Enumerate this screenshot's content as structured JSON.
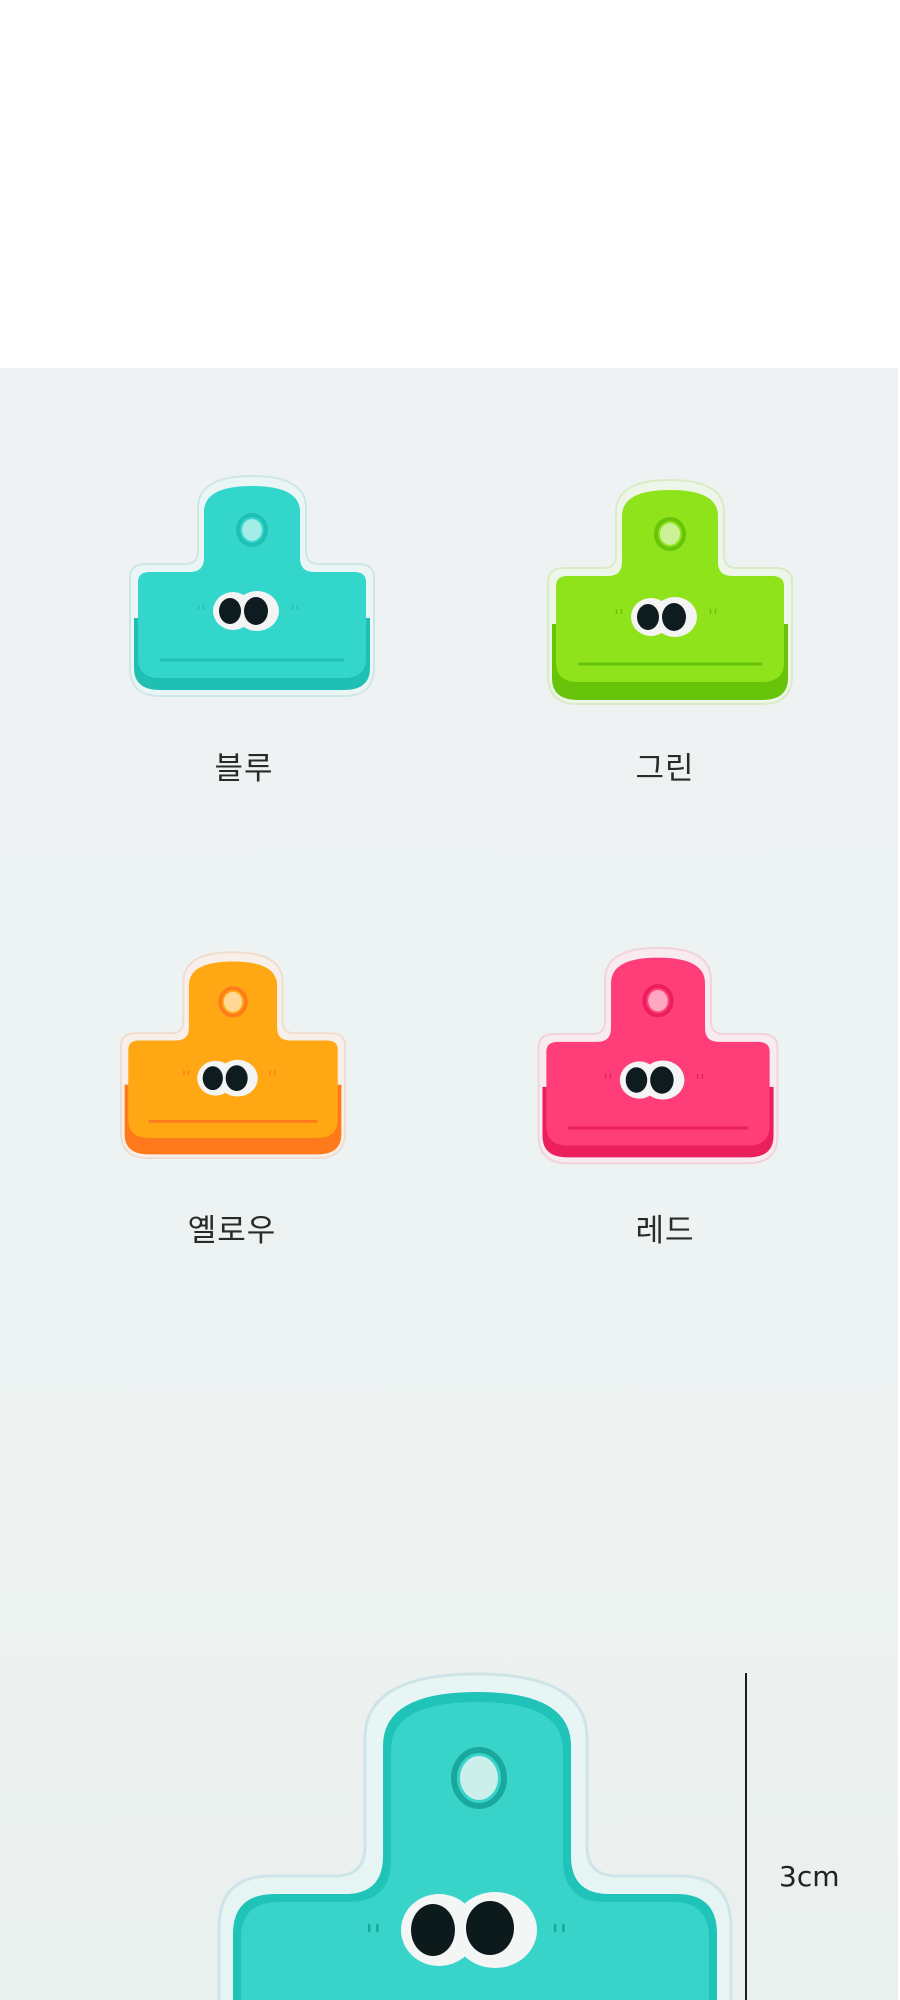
{
  "variants": [
    {
      "label": "블루",
      "color": "#33d6cb",
      "dark": "#20bfb4",
      "light": "#8ff0e8"
    },
    {
      "label": "그린",
      "color": "#8ee31a",
      "dark": "#67c40a",
      "light": "#c6f57e"
    },
    {
      "label": "옐로우",
      "color": "#ffa814",
      "dark": "#ff7a1a",
      "light": "#ffd27a"
    },
    {
      "label": "레드",
      "color": "#ff3d78",
      "dark": "#ea1f5c",
      "light": "#ff9fbd"
    }
  ],
  "measure": {
    "label": "3cm"
  }
}
